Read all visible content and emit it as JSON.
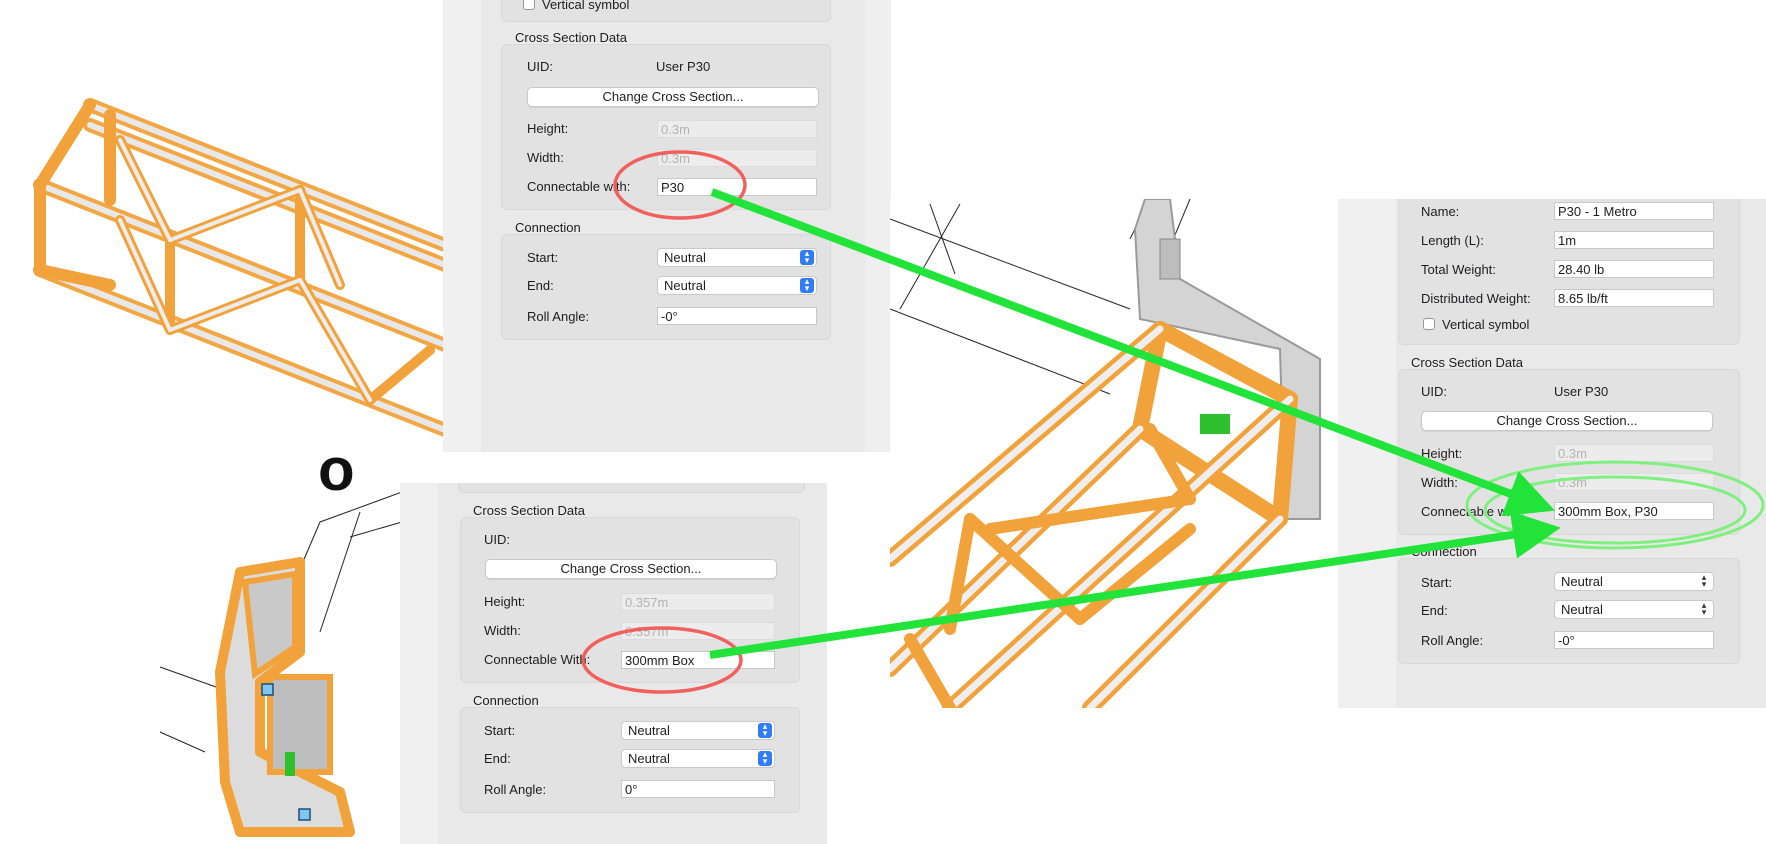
{
  "panel_top_left": {
    "vertical_symbol_label": "Vertical symbol",
    "cross_section_title": "Cross Section Data",
    "uid_label": "UID:",
    "uid_value": "User P30",
    "change_button": "Change Cross Section...",
    "height_label": "Height:",
    "height_value": "0.3m",
    "width_label": "Width:",
    "width_value": "0.3m",
    "connectable_label": "Connectable with:",
    "connectable_value": "P30",
    "connection_title": "Connection",
    "start_label": "Start:",
    "start_value": "Neutral",
    "end_label": "End:",
    "end_value": "Neutral",
    "roll_label": "Roll Angle:",
    "roll_value": "-0°"
  },
  "panel_bottom": {
    "cross_section_title": "Cross Section Data",
    "uid_label": "UID:",
    "uid_value": "",
    "change_button": "Change Cross Section...",
    "height_label": "Height:",
    "height_value": "0.357m",
    "width_label": "Width:",
    "width_value": "0.357m",
    "connectable_label": "Connectable With:",
    "connectable_value": "300mm Box",
    "connection_title": "Connection",
    "start_label": "Start:",
    "start_value": "Neutral",
    "end_label": "End:",
    "end_value": "Neutral",
    "roll_label": "Roll Angle:",
    "roll_value": "0°"
  },
  "panel_right": {
    "name_label": "Name:",
    "name_value": "P30 - 1 Metro",
    "length_label": "Length (L):",
    "length_value": "1m",
    "total_weight_label": "Total Weight:",
    "total_weight_value": "28.40 lb",
    "distributed_weight_label": "Distributed Weight:",
    "distributed_weight_value": "8.65 lb/ft",
    "vertical_symbol_label": "Vertical symbol",
    "cross_section_title": "Cross Section Data",
    "uid_label": "UID:",
    "uid_value": "User P30",
    "change_button": "Change Cross Section...",
    "height_label": "Height:",
    "height_value": "0.3m",
    "width_label": "Width:",
    "width_value": "0.3m",
    "connectable_label": "Connectable with:",
    "connectable_value": "300mm Box, P30",
    "connection_title": "Connection",
    "start_label": "Start:",
    "start_value": "Neutral",
    "end_label": "End:",
    "end_value": "Neutral",
    "roll_label": "Roll Angle:",
    "roll_value": "-0°"
  },
  "colors": {
    "truss_orange": "#f2a23a",
    "annotation_red": "#f0605c",
    "annotation_green": "#22e33a",
    "highlight_green": "#7ff07f",
    "popup_blue": "#2f7cf6"
  },
  "icons": [
    "up-down-arrows-icon",
    "checkbox-icon"
  ]
}
